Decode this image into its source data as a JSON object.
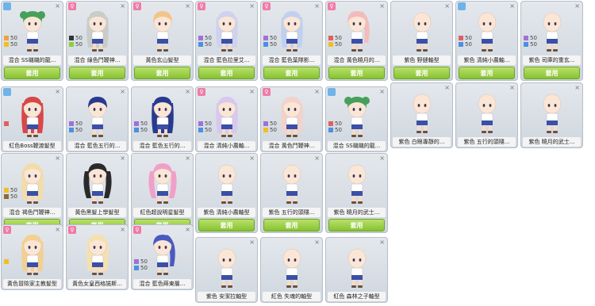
{
  "ui": {
    "use_label": "套用",
    "close_glyph": "×",
    "badge_female": "♀"
  },
  "cards": [
    {
      "name": "混合 SS嘰嘰的龍...",
      "badge": "blue",
      "stats": [
        {
          "color": "#f0a040",
          "value": "50"
        },
        {
          "color": "#f0c020",
          "value": "50"
        }
      ],
      "hair_color": "#46a05a",
      "hair_style": "bun",
      "has_button": true
    },
    {
      "name": "混合 綠色鬥鞭神...",
      "badge": "pink",
      "stats": [
        {
          "color": "#333333",
          "value": "50"
        },
        {
          "color": "#8ccf3a",
          "value": "50"
        }
      ],
      "hair_color": "#c9ccc8",
      "hair_style": "long",
      "has_button": true
    },
    {
      "name": "黃色玄山髮型",
      "badge": "pink",
      "stats": [],
      "hair_color": "#f2c48a",
      "hair_style": "short",
      "has_button": true
    },
    {
      "name": "混合 藍色拉里艾...",
      "badge": "pink",
      "stats": [
        {
          "color": "#a070d8",
          "value": "50"
        },
        {
          "color": "#4d8fe0",
          "value": "50"
        }
      ],
      "hair_color": "#cfd2ef",
      "hair_style": "long",
      "has_button": true
    },
    {
      "name": "混合 藍色葉隊影...",
      "badge": "pink",
      "stats": [
        {
          "color": "#a070d8",
          "value": "50"
        },
        {
          "color": "#4d8fe0",
          "value": "50"
        }
      ],
      "hair_color": "#c0d0f0",
      "hair_style": "long",
      "has_button": true
    },
    {
      "name": "混合 黃色曉月的...",
      "badge": "pink",
      "stats": [
        {
          "color": "#e06060",
          "value": "50"
        },
        {
          "color": "#f0c020",
          "value": "50"
        }
      ],
      "hair_color": "#f2bcbc",
      "hair_style": "pony",
      "has_button": true
    },
    {
      "name": "紫色 野鏈軸型",
      "badge": "",
      "stats": [],
      "hair_color": "",
      "hair_style": "bald",
      "has_button": true
    },
    {
      "name": "紫色 清純小農軸...",
      "badge": "blue",
      "stats": [
        {
          "color": "#e06060",
          "value": "50"
        },
        {
          "color": "#4d8fe0",
          "value": "50"
        }
      ],
      "hair_color": "",
      "hair_style": "bald",
      "has_button": true
    },
    {
      "name": "紫色 司庫的重玄...",
      "badge": "",
      "stats": [
        {
          "color": "#a070d8",
          "value": "50"
        },
        {
          "color": "#4d8fe0",
          "value": "50"
        }
      ],
      "hair_color": "",
      "hair_style": "bald",
      "has_button": true
    },
    {
      "name": "紅色Boss鞭渡髮型",
      "badge": "blue",
      "stats": [
        {
          "color": "#e06060",
          "value": ""
        }
      ],
      "hair_color": "#d84848",
      "hair_style": "long",
      "has_button": false
    },
    {
      "name": "混合 藍色五行的...",
      "badge": "",
      "stats": [
        {
          "color": "#a070d8",
          "value": "50"
        },
        {
          "color": "#4d8fe0",
          "value": "50"
        }
      ],
      "hair_color": "#283a90",
      "hair_style": "cap",
      "has_button": false
    },
    {
      "name": "混合 藍色五行的...",
      "badge": "",
      "stats": [
        {
          "color": "#a070d8",
          "value": "50"
        },
        {
          "color": "#4d8fe0",
          "value": "50"
        }
      ],
      "hair_color": "#283a90",
      "hair_style": "long",
      "has_button": false
    },
    {
      "name": "混合 清純小農軸...",
      "badge": "pink",
      "stats": [
        {
          "color": "#a070d8",
          "value": "50"
        },
        {
          "color": "#4d8fe0",
          "value": "50"
        }
      ],
      "hair_color": "#d8c8ef",
      "hair_style": "long",
      "has_button": false
    },
    {
      "name": "混合 黃色鬥鞭神...",
      "badge": "pink",
      "stats": [
        {
          "color": "#a070d8",
          "value": "50"
        },
        {
          "color": "#f0c020",
          "value": "50"
        }
      ],
      "hair_color": "#f2d2cc",
      "hair_style": "long",
      "has_button": false
    },
    {
      "name": "混合 SS嘰嘰的龍...",
      "badge": "blue",
      "stats": [
        {
          "color": "#e06060",
          "value": "50"
        },
        {
          "color": "#4d8fe0",
          "value": "50"
        }
      ],
      "hair_color": "#46a05a",
      "hair_style": "bun",
      "has_button": false
    },
    {
      "name": "紫色 白眼專靜的...",
      "badge": "",
      "stats": [],
      "hair_color": "",
      "hair_style": "bald",
      "has_button": false
    },
    {
      "name": "紫色 五行的頭隱...",
      "badge": "",
      "stats": [],
      "hair_color": "",
      "hair_style": "bald",
      "has_button": false
    },
    {
      "name": "紫色 曉月的武士...",
      "badge": "",
      "stats": [],
      "hair_color": "",
      "hair_style": "bald",
      "has_button": false
    },
    {
      "name": "混合 褐色鬥鞭神...",
      "badge": "",
      "stats": [
        {
          "color": "#f0c020",
          "value": "50"
        },
        {
          "color": "#8a6a3a",
          "value": "50"
        }
      ],
      "hair_color": "#f2dca8",
      "hair_style": "long",
      "has_button": true
    },
    {
      "name": "黃色黑髮上學髮型",
      "badge": "",
      "stats": [],
      "hair_color": "#2a2a2a",
      "hair_style": "twin",
      "has_button": true
    },
    {
      "name": "紅色超說明星髮型",
      "badge": "",
      "stats": [],
      "hair_color": "#f0a0c8",
      "hair_style": "twin",
      "has_button": true
    },
    {
      "name": "紫色 清純小農軸型",
      "badge": "",
      "stats": [],
      "hair_color": "",
      "hair_style": "bald",
      "has_button": true
    },
    {
      "name": "紫色 五行的頭隱...",
      "badge": "",
      "stats": [],
      "hair_color": "",
      "hair_style": "bald",
      "has_button": true
    },
    {
      "name": "紫色 曉月的武士...",
      "badge": "",
      "stats": [],
      "hair_color": "",
      "hair_style": "bald",
      "has_button": true
    },
    {
      "name": "黃色冒險家主教髮型",
      "badge": "pink",
      "stats": [
        {
          "color": "#f0c020",
          "value": ""
        }
      ],
      "hair_color": "#f2d090",
      "hair_style": "long",
      "has_button": false
    },
    {
      "name": "黃色女皇西格諾斯...",
      "badge": "pink",
      "stats": [],
      "hair_color": "#f4e0b0",
      "hair_style": "long",
      "has_button": false
    },
    {
      "name": "混合 藍色蒔東層...",
      "badge": "pink",
      "stats": [
        {
          "color": "#a070d8",
          "value": "50"
        },
        {
          "color": "#4d8fe0",
          "value": "50"
        }
      ],
      "hair_color": "#4a5ac0",
      "hair_style": "pony",
      "has_button": false
    },
    {
      "name": "紫色 安潔拉軸型",
      "badge": "",
      "stats": [],
      "hair_color": "",
      "hair_style": "bald",
      "has_button": false
    },
    {
      "name": "紅色 失魂的軸型",
      "badge": "",
      "stats": [],
      "hair_color": "",
      "hair_style": "bald",
      "has_button": false
    },
    {
      "name": "紅色 森林之子軸型",
      "badge": "",
      "stats": [],
      "hair_color": "",
      "hair_style": "bald",
      "has_button": false
    }
  ]
}
